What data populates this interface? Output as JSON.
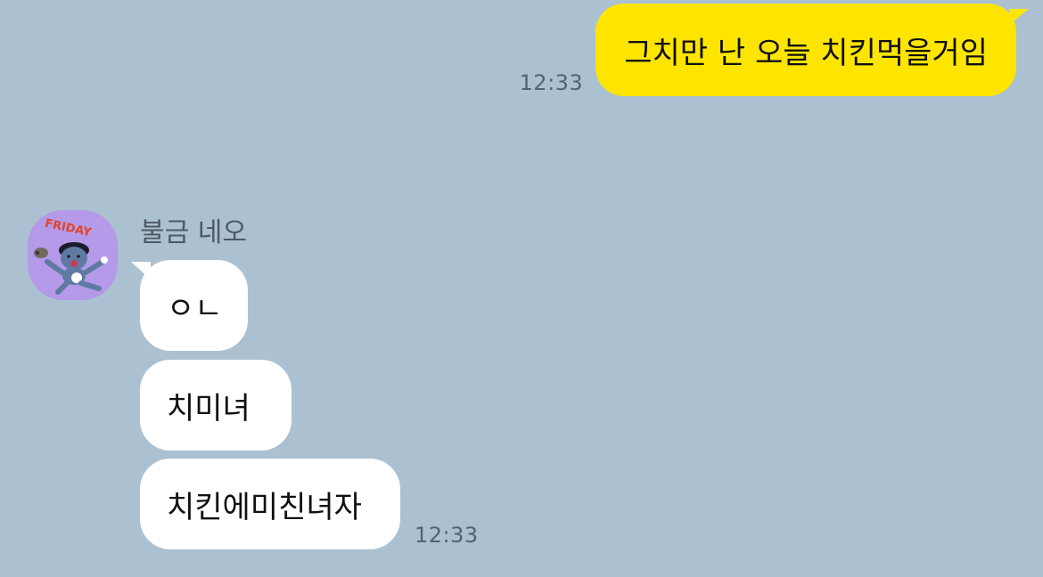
{
  "chat": {
    "background_color": "#abc1d1",
    "outgoing": [
      {
        "text": "그치만 난 오늘 치킨먹을거임",
        "time": "12:33"
      }
    ],
    "incoming_group": {
      "sender_name": "불금 네오",
      "avatar_icon": "neo-friday-sticker-avatar",
      "avatar_logo_text": "FRIDAY",
      "messages": [
        {
          "text": "ㅇㄴ"
        },
        {
          "text": "치미녀"
        },
        {
          "text": "치킨에미친녀자"
        }
      ],
      "time": "12:33"
    }
  },
  "colors": {
    "outgoing_bubble": "#fee500",
    "incoming_bubble": "#ffffff",
    "avatar_bg": "#b49ae8"
  }
}
